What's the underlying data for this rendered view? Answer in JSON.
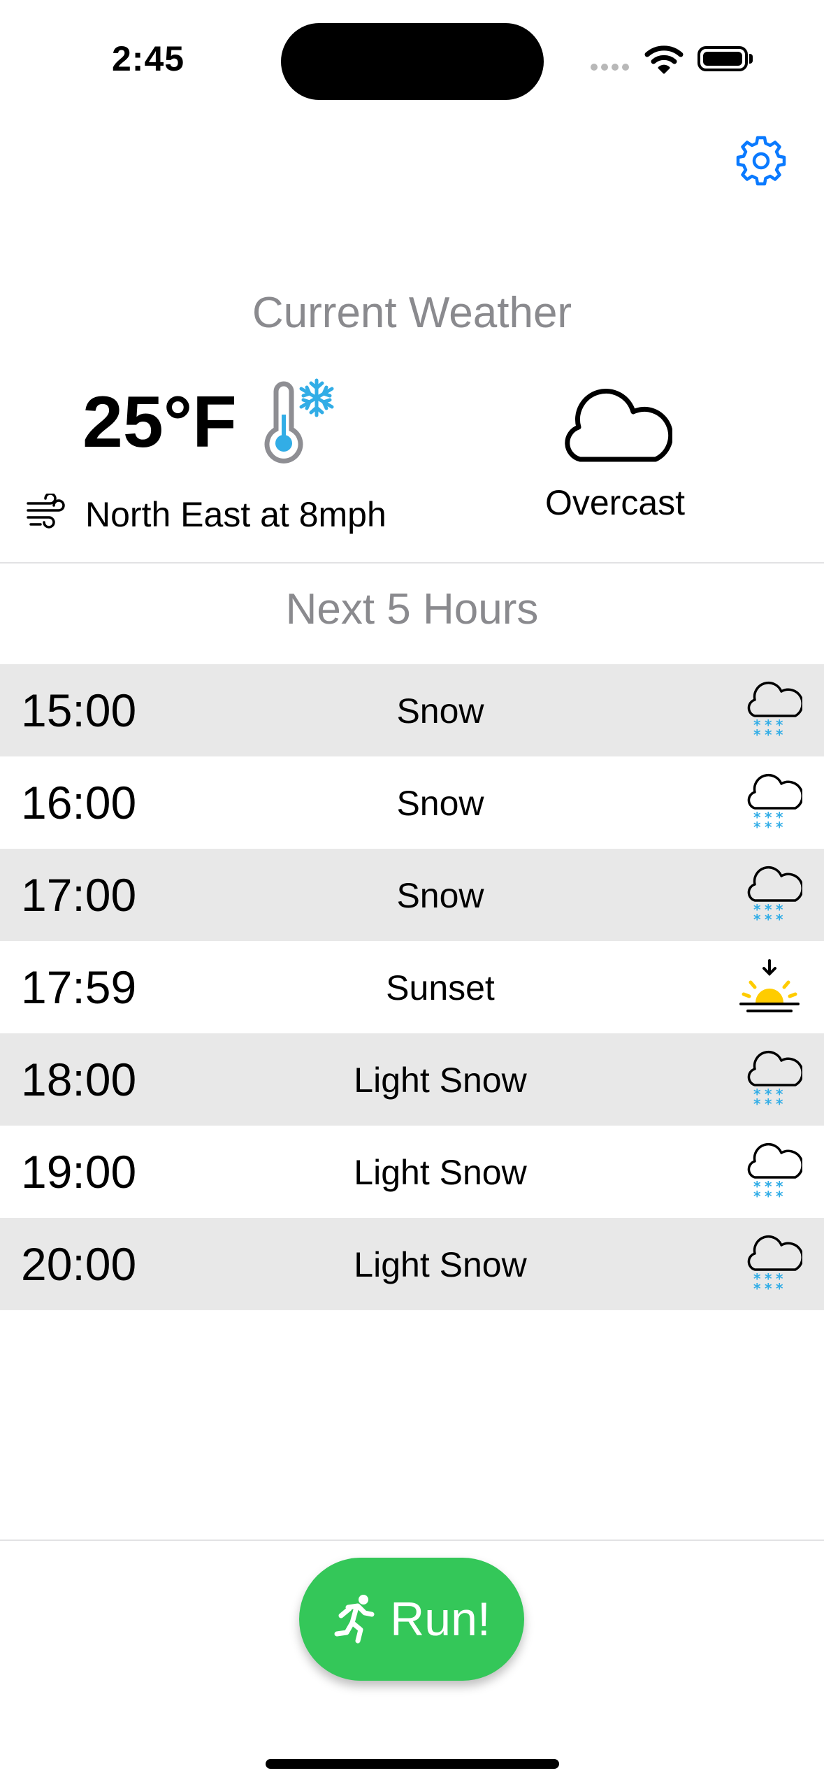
{
  "status_bar": {
    "time": "2:45"
  },
  "current": {
    "title": "Current Weather",
    "temperature": "25°F",
    "wind": "North East at 8mph",
    "condition": "Overcast"
  },
  "forecast": {
    "title": "Next 5 Hours",
    "rows": [
      {
        "time": "15:00",
        "desc": "Snow",
        "icon": "snow-icon"
      },
      {
        "time": "16:00",
        "desc": "Snow",
        "icon": "snow-icon"
      },
      {
        "time": "17:00",
        "desc": "Snow",
        "icon": "snow-icon"
      },
      {
        "time": "17:59",
        "desc": "Sunset",
        "icon": "sunset-icon"
      },
      {
        "time": "18:00",
        "desc": "Light Snow",
        "icon": "snow-icon"
      },
      {
        "time": "19:00",
        "desc": "Light Snow",
        "icon": "snow-icon"
      },
      {
        "time": "20:00",
        "desc": "Light Snow",
        "icon": "snow-icon"
      }
    ]
  },
  "run_button": {
    "label": "Run!"
  },
  "colors": {
    "accent_blue": "#0a7aff",
    "run_green": "#34c759",
    "row_shade": "#e8e8e8",
    "snow_blue": "#32ade6",
    "sun_yellow": "#ffcc00"
  }
}
